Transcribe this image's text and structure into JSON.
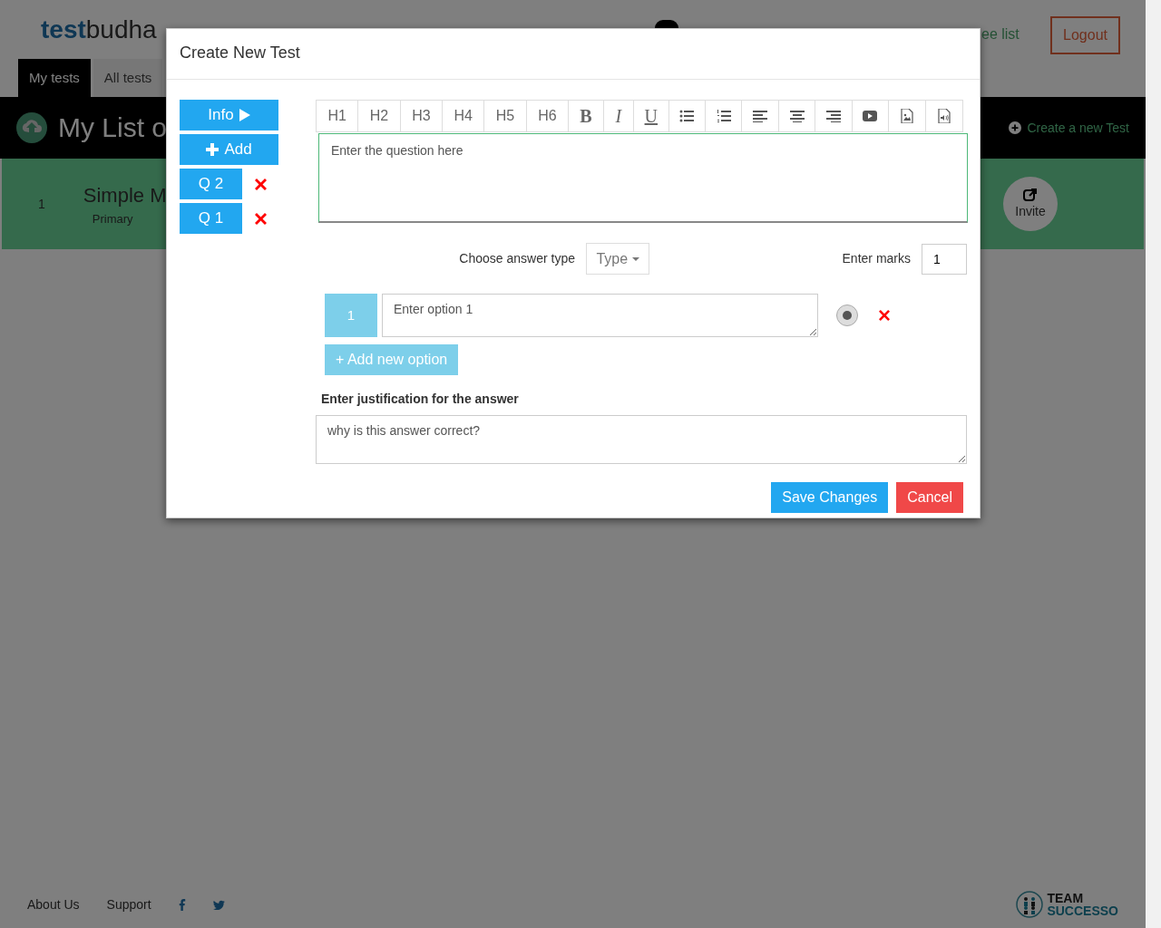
{
  "header": {
    "logo_bold": "test",
    "logo_light": "budha",
    "link_fragment": "ee list",
    "logout": "Logout"
  },
  "tabs": [
    {
      "label": "My tests",
      "selected": true
    },
    {
      "label": "All tests",
      "selected": false
    }
  ],
  "list_bar": {
    "title": "My List o",
    "create": "Create a new Test"
  },
  "tests": [
    {
      "number": "1",
      "title": "Simple M",
      "category": "Primary",
      "invite": "Invite"
    }
  ],
  "footer": {
    "links": [
      "About Us",
      "Support"
    ],
    "brand_top": "TEAM",
    "brand_bottom": "SUCCESSO"
  },
  "modal": {
    "title": "Create New Test",
    "side": [
      {
        "kind": "info",
        "label": "Info"
      },
      {
        "kind": "add",
        "label": "Add"
      },
      {
        "kind": "question",
        "label": "Q 2"
      },
      {
        "kind": "question",
        "label": "Q 1"
      }
    ],
    "toolbar": [
      {
        "kind": "heading",
        "label": "H1"
      },
      {
        "kind": "heading",
        "label": "H2"
      },
      {
        "kind": "heading",
        "label": "H3"
      },
      {
        "kind": "heading",
        "label": "H4"
      },
      {
        "kind": "heading",
        "label": "H5"
      },
      {
        "kind": "heading",
        "label": "H6"
      },
      {
        "kind": "bold",
        "label": "B"
      },
      {
        "kind": "italic",
        "label": "I"
      },
      {
        "kind": "underline",
        "label": "U"
      },
      {
        "kind": "bullet-list"
      },
      {
        "kind": "numbered-list"
      },
      {
        "kind": "align-left"
      },
      {
        "kind": "align-center"
      },
      {
        "kind": "align-right"
      },
      {
        "kind": "video"
      },
      {
        "kind": "image"
      },
      {
        "kind": "audio"
      }
    ],
    "question_placeholder": "Enter the question here",
    "answer_type_label": "Choose answer type",
    "type_button": "Type",
    "marks_label": "Enter marks",
    "marks_value": "1",
    "options": [
      {
        "number": "1",
        "placeholder": "Enter option 1",
        "selected": true
      }
    ],
    "add_option": "+ Add new option",
    "justification_label": "Enter justification for the answer",
    "justification_placeholder": "why is this answer correct?",
    "buttons": [
      {
        "kind": "primary",
        "label": "Save Changes"
      },
      {
        "kind": "danger",
        "label": "Cancel"
      }
    ]
  }
}
